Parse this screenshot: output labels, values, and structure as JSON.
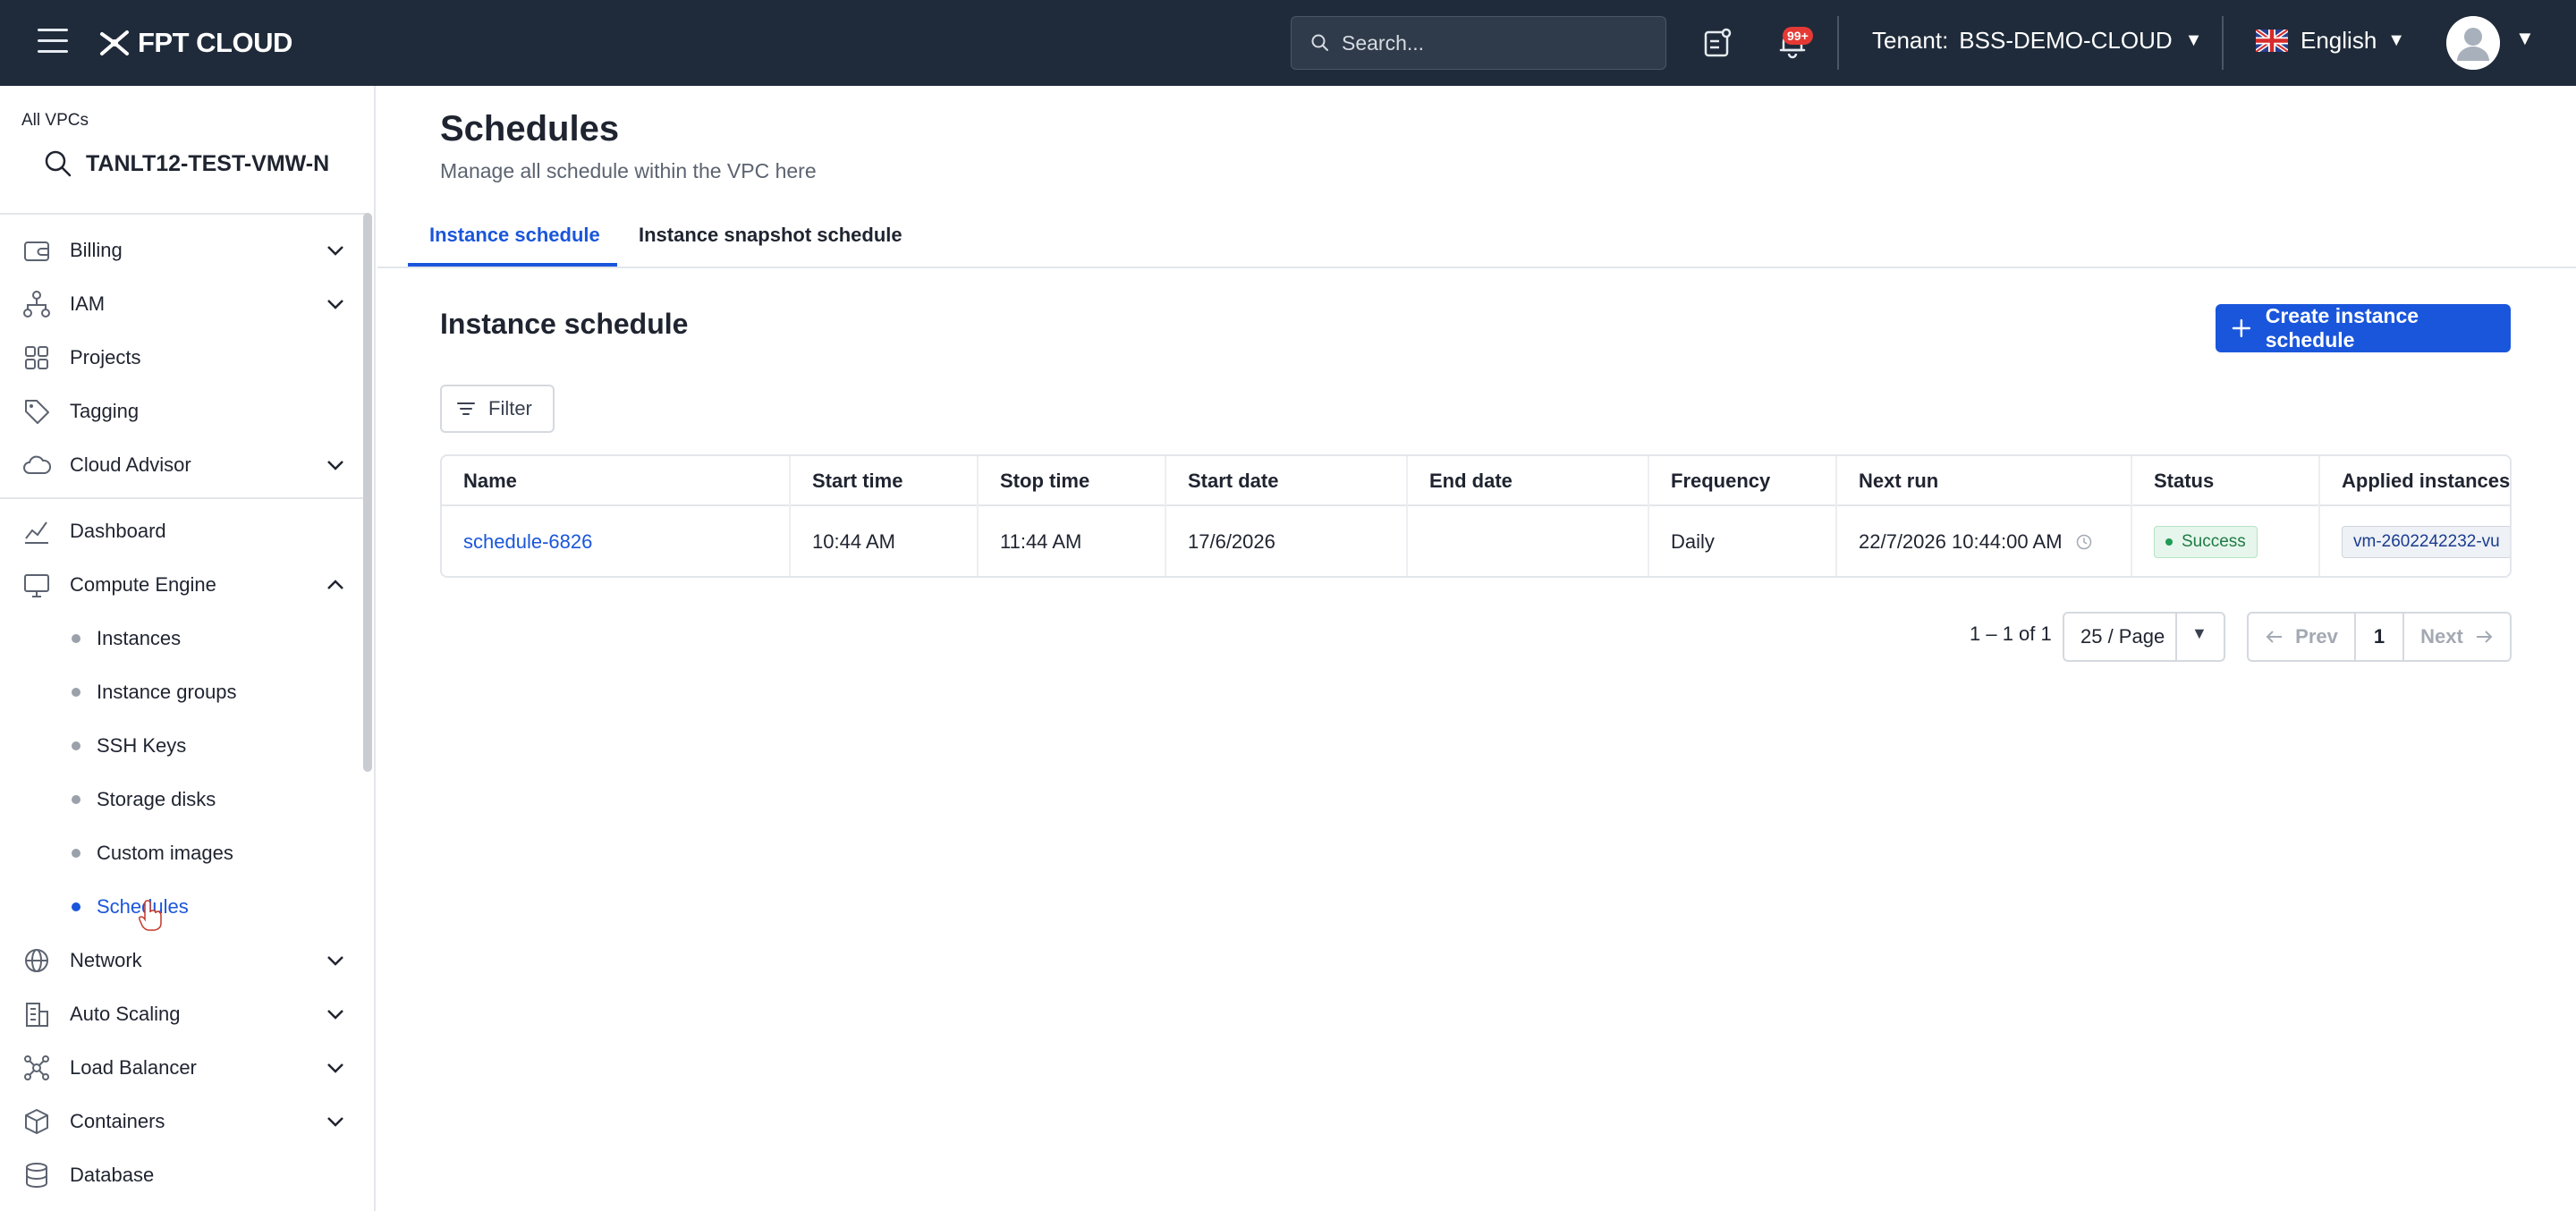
{
  "topbar": {
    "logo_text": "FPT CLOUD",
    "search_placeholder": "Search...",
    "notification_badge": "99+",
    "tenant_label": "Tenant:",
    "tenant_value": "BSS-DEMO-CLOUD",
    "language": "English"
  },
  "sidebar": {
    "vpc_label": "All VPCs",
    "vpc_name": "TANLT12-TEST-VMW-N",
    "items": [
      {
        "label": "Billing"
      },
      {
        "label": "IAM"
      },
      {
        "label": "Projects"
      },
      {
        "label": "Tagging"
      },
      {
        "label": "Cloud Advisor"
      },
      {
        "label": "Dashboard"
      },
      {
        "label": "Compute Engine"
      },
      {
        "label": "Network"
      },
      {
        "label": "Auto Scaling"
      },
      {
        "label": "Load Balancer"
      },
      {
        "label": "Containers"
      },
      {
        "label": "Database"
      }
    ],
    "compute_sub": [
      {
        "label": "Instances"
      },
      {
        "label": "Instance groups"
      },
      {
        "label": "SSH Keys"
      },
      {
        "label": "Storage disks"
      },
      {
        "label": "Custom images"
      },
      {
        "label": "Schedules"
      }
    ]
  },
  "main": {
    "title": "Schedules",
    "subtitle": "Manage all schedule within the VPC here",
    "tabs": [
      {
        "label": "Instance schedule"
      },
      {
        "label": "Instance snapshot schedule"
      }
    ],
    "section_title": "Instance schedule",
    "create_button": "Create instance schedule",
    "filter_button": "Filter",
    "table": {
      "columns": [
        "Name",
        "Start time",
        "Stop time",
        "Start date",
        "End date",
        "Frequency",
        "Next run",
        "Status",
        "Applied instances"
      ],
      "rows": [
        {
          "name": "schedule-6826",
          "start_time": "10:44 AM",
          "stop_time": "11:44 AM",
          "start_date": "17/6/2026",
          "end_date": "",
          "frequency": "Daily",
          "next_run": "22/7/2026 10:44:00 AM",
          "status": "Success",
          "applied_instance": "vm-2602242232-vu"
        }
      ]
    },
    "pagination": {
      "range": "1 – 1 of 1",
      "page_size": "25 / Page",
      "prev": "Prev",
      "current_page": "1",
      "next": "Next"
    }
  },
  "colors": {
    "topbar_bg": "#1f2b3a",
    "accent": "#1a56db",
    "success": "#1f9d55",
    "badge_red": "#e53935"
  }
}
